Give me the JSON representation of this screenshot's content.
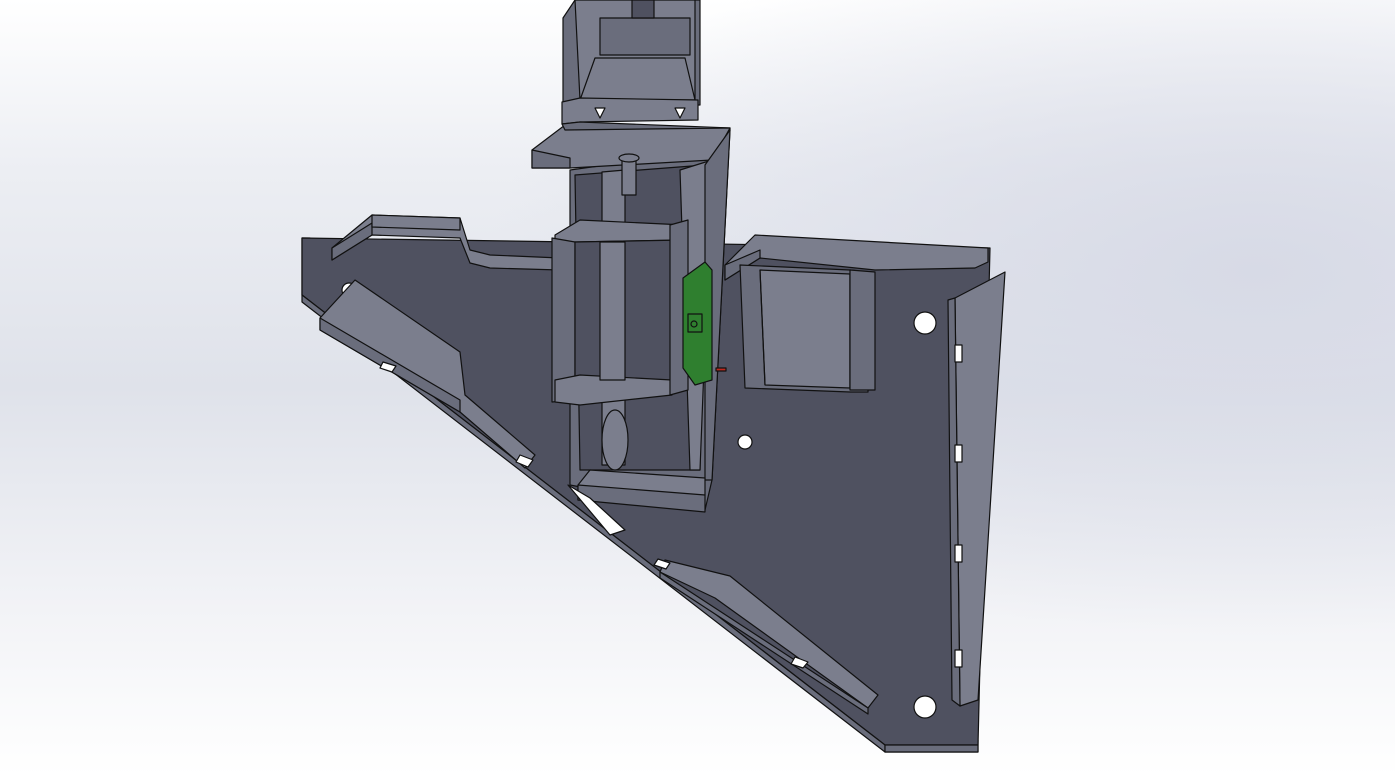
{
  "viewport": {
    "background_top": "#ffffff",
    "background_mid": "#dfe2ea",
    "background_bottom": "#ffffff"
  },
  "model": {
    "body_color": "#4f5160",
    "side_color": "#6a6d7c",
    "top_color": "#7b7e8d",
    "edge_color": "#111111",
    "hole_color": "#ffffff",
    "pcb_color": "#2f7f2f",
    "marker_color": "#c0281e"
  }
}
